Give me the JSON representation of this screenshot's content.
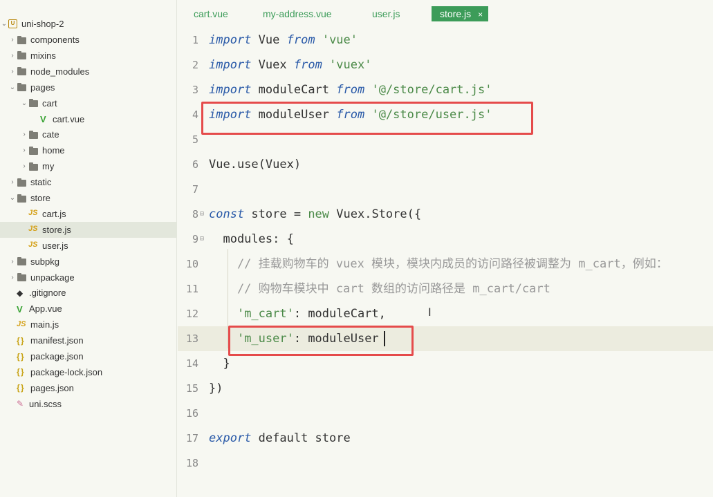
{
  "sidebar": {
    "project": "uni-shop-2",
    "items": [
      {
        "label": "components",
        "kind": "folder",
        "depth": 1,
        "chevron": "closed"
      },
      {
        "label": "mixins",
        "kind": "folder",
        "depth": 1,
        "chevron": "closed"
      },
      {
        "label": "node_modules",
        "kind": "folder",
        "depth": 1,
        "chevron": "closed"
      },
      {
        "label": "pages",
        "kind": "folder",
        "depth": 1,
        "chevron": "open"
      },
      {
        "label": "cart",
        "kind": "folder",
        "depth": 2,
        "chevron": "open"
      },
      {
        "label": "cart.vue",
        "kind": "vue",
        "depth": 3
      },
      {
        "label": "cate",
        "kind": "folder",
        "depth": 2,
        "chevron": "closed"
      },
      {
        "label": "home",
        "kind": "folder",
        "depth": 2,
        "chevron": "closed"
      },
      {
        "label": "my",
        "kind": "folder",
        "depth": 2,
        "chevron": "closed"
      },
      {
        "label": "static",
        "kind": "folder",
        "depth": 1,
        "chevron": "closed"
      },
      {
        "label": "store",
        "kind": "folder",
        "depth": 1,
        "chevron": "open"
      },
      {
        "label": "cart.js",
        "kind": "js",
        "depth": 2
      },
      {
        "label": "store.js",
        "kind": "js",
        "depth": 2,
        "selected": true
      },
      {
        "label": "user.js",
        "kind": "js",
        "depth": 2
      },
      {
        "label": "subpkg",
        "kind": "folder",
        "depth": 1,
        "chevron": "closed"
      },
      {
        "label": "unpackage",
        "kind": "folder",
        "depth": 1,
        "chevron": "closed"
      },
      {
        "label": ".gitignore",
        "kind": "git",
        "depth": 1
      },
      {
        "label": "App.vue",
        "kind": "vue",
        "depth": 1
      },
      {
        "label": "main.js",
        "kind": "js",
        "depth": 1
      },
      {
        "label": "manifest.json",
        "kind": "json",
        "depth": 1
      },
      {
        "label": "package.json",
        "kind": "json",
        "depth": 1
      },
      {
        "label": "package-lock.json",
        "kind": "json",
        "depth": 1
      },
      {
        "label": "pages.json",
        "kind": "json",
        "depth": 1
      },
      {
        "label": "uni.scss",
        "kind": "scss",
        "depth": 1
      }
    ]
  },
  "tabs": [
    {
      "label": "cart.vue"
    },
    {
      "label": "my-address.vue"
    },
    {
      "label": "user.js"
    },
    {
      "label": "store.js",
      "active": true,
      "close": "×"
    }
  ],
  "editor": {
    "lines": [
      {
        "n": "1",
        "tokens": [
          [
            "kw",
            "import"
          ],
          [
            "",
            "Vue "
          ],
          [
            "kw",
            "from"
          ],
          [
            "",
            " "
          ],
          [
            "str",
            "'vue'"
          ]
        ]
      },
      {
        "n": "2",
        "tokens": [
          [
            "kw",
            "import"
          ],
          [
            "",
            "Vuex "
          ],
          [
            "kw",
            "from"
          ],
          [
            "",
            " "
          ],
          [
            "str",
            "'vuex'"
          ]
        ]
      },
      {
        "n": "3",
        "tokens": [
          [
            "kw",
            "import"
          ],
          [
            "",
            "moduleCart "
          ],
          [
            "kw",
            "from"
          ],
          [
            "",
            " "
          ],
          [
            "str",
            "'@/store/cart.js'"
          ]
        ]
      },
      {
        "n": "4",
        "tokens": [
          [
            "kw",
            "import"
          ],
          [
            "",
            "moduleUser "
          ],
          [
            "kw",
            "from"
          ],
          [
            "",
            " "
          ],
          [
            "str",
            "'@/store/user.js'"
          ]
        ]
      },
      {
        "n": "5",
        "tokens": []
      },
      {
        "n": "6",
        "tokens": [
          [
            "",
            "Vue.use(Vuex)"
          ]
        ]
      },
      {
        "n": "7",
        "tokens": []
      },
      {
        "n": "8",
        "fold": "⊟",
        "tokens": [
          [
            "kw",
            "const"
          ],
          [
            "",
            " store = "
          ],
          [
            "str",
            "new"
          ],
          [
            "",
            " Vuex.Store({"
          ]
        ]
      },
      {
        "n": "9",
        "fold": "⊟",
        "tokens": [
          [
            "",
            "  modules: {"
          ]
        ]
      },
      {
        "n": "10",
        "tokens": [
          [
            "cmt",
            "    // 挂载购物车的 vuex 模块，模块内成员的访问路径被调整为 m_cart，例如："
          ]
        ]
      },
      {
        "n": "11",
        "tokens": [
          [
            "cmt",
            "    // 购物车模块中 cart 数组的访问路径是 m_cart/cart"
          ]
        ]
      },
      {
        "n": "12",
        "tokens": [
          [
            "",
            "    "
          ],
          [
            "str",
            "'m_cart'"
          ],
          [
            "",
            ": moduleCart,"
          ]
        ]
      },
      {
        "n": "13",
        "current": true,
        "tokens": [
          [
            "",
            "    "
          ],
          [
            "str",
            "'m_user'"
          ],
          [
            "",
            ": moduleUser"
          ]
        ]
      },
      {
        "n": "14",
        "tokens": [
          [
            "",
            "  }"
          ]
        ]
      },
      {
        "n": "15",
        "tokens": [
          [
            "",
            "})"
          ]
        ]
      },
      {
        "n": "16",
        "tokens": []
      },
      {
        "n": "17",
        "tokens": [
          [
            "kw",
            "export"
          ],
          [
            "",
            " default store"
          ]
        ]
      },
      {
        "n": "18",
        "tokens": []
      }
    ]
  },
  "colors": {
    "accent": "#3c9c59",
    "keyword": "#2a5aa8",
    "string": "#4b8a48",
    "comment": "#999999",
    "highlight_box": "#e54b4b"
  }
}
